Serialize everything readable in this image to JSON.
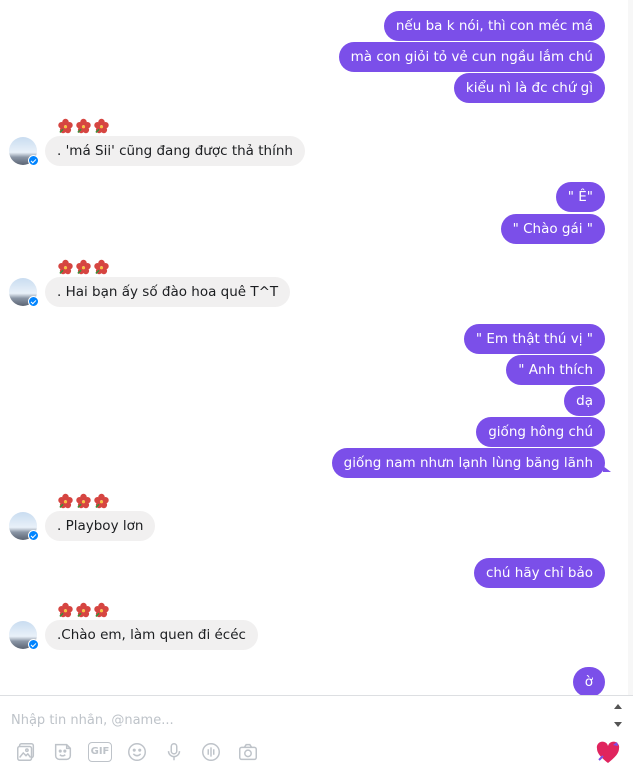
{
  "messages": [
    {
      "side": "out",
      "text": "nếu ba k nói, thì con méc má"
    },
    {
      "side": "out",
      "text": "mà con giỏi tỏ vẻ cun ngầu lắm chú"
    },
    {
      "side": "out",
      "text": "kiểu nì là đc chứ gì"
    },
    {
      "side": "in",
      "text": ". 'má Sii' cũng đang được thả thính"
    },
    {
      "side": "out",
      "text": "\" Ê\""
    },
    {
      "side": "out",
      "text": "\" Chào gái \""
    },
    {
      "side": "in",
      "text": ". Hai bạn ấy số đào hoa quê T^T"
    },
    {
      "side": "out",
      "text": "\" Em thật thú vị \""
    },
    {
      "side": "out",
      "text": "\" Anh thích"
    },
    {
      "side": "out",
      "text": "dạ"
    },
    {
      "side": "out",
      "text": "giống hông chú"
    },
    {
      "side": "out",
      "text": "giống nam nhưn lạnh lùng băng lãnh"
    },
    {
      "side": "in",
      "text": ". Playboy lơn"
    },
    {
      "side": "out",
      "text": "chú hãy chỉ bảo"
    },
    {
      "side": "in",
      "text": ".Chào em, làm quen đi écéc"
    },
    {
      "side": "out",
      "text": "ờ"
    }
  ],
  "reaction_icon": "hibiscus-flower-icon",
  "composer": {
    "placeholder": "Nhập tin nhắn, @name...",
    "tools": [
      "photo-icon",
      "sticker-icon",
      "gif-icon",
      "emoji-icon",
      "microphone-icon",
      "voice-clip-icon",
      "camera-icon"
    ],
    "gif_label": "GIF",
    "send_icon": "heart-reaction-icon"
  },
  "colors": {
    "outgoing_bubble": "#7b4fe9",
    "incoming_bubble": "#f1f0f0",
    "badge": "#0084ff",
    "flower": "#d64541"
  }
}
